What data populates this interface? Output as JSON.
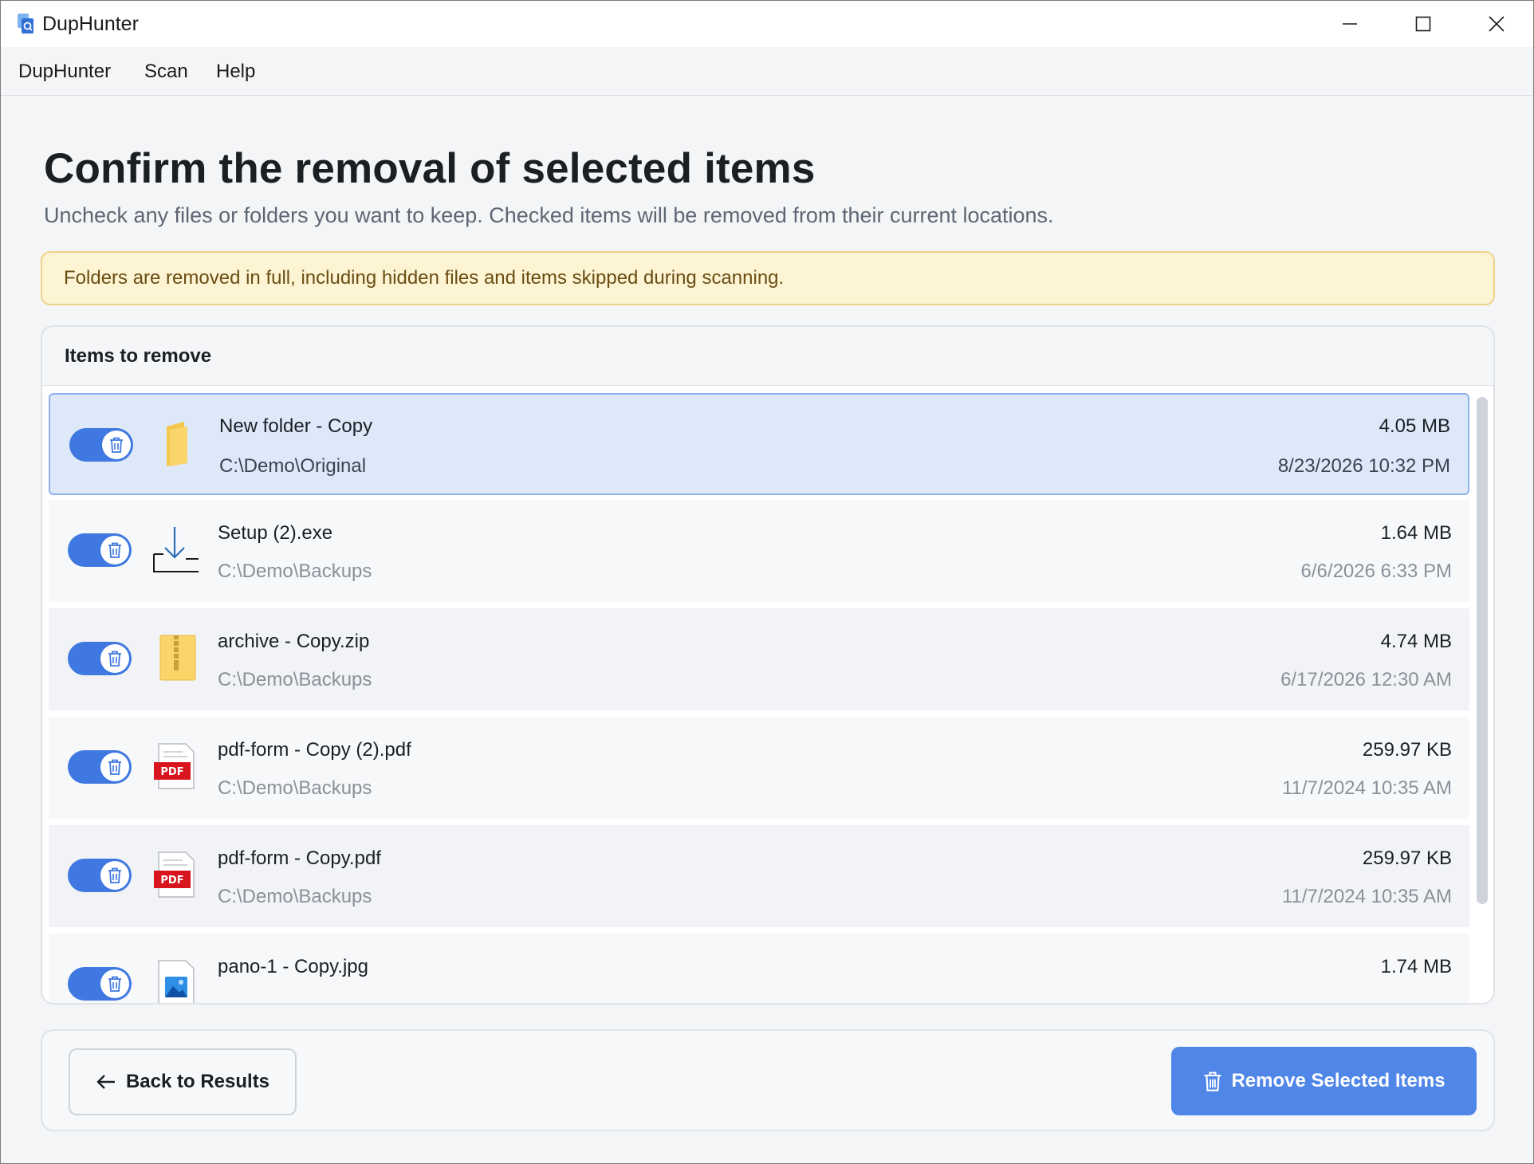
{
  "app": {
    "title": "DupHunter"
  },
  "menu": {
    "items": [
      "DupHunter",
      "Scan",
      "Help"
    ]
  },
  "header": {
    "title": "Confirm the removal of selected items",
    "subtitle": "Uncheck any files or folders you want to keep. Checked items will be removed from their current locations."
  },
  "warning": {
    "text": "Folders are removed in full, including hidden files and items skipped during scanning."
  },
  "panel": {
    "title": "Items to remove"
  },
  "items": [
    {
      "name": "New folder - Copy",
      "path": "C:\\Demo\\Original",
      "size": "4.05 MB",
      "date": "8/23/2026 10:32 PM",
      "icon": "folder-icon",
      "checked": true
    },
    {
      "name": "Setup (2).exe",
      "path": "C:\\Demo\\Backups",
      "size": "1.64 MB",
      "date": "6/6/2026 6:33 PM",
      "icon": "installer-icon",
      "checked": true
    },
    {
      "name": "archive - Copy.zip",
      "path": "C:\\Demo\\Backups",
      "size": "4.74 MB",
      "date": "6/17/2026 12:30 AM",
      "icon": "zip-folder-icon",
      "checked": true
    },
    {
      "name": "pdf-form - Copy (2).pdf",
      "path": "C:\\Demo\\Backups",
      "size": "259.97 KB",
      "date": "11/7/2024 10:35 AM",
      "icon": "pdf-icon",
      "checked": true
    },
    {
      "name": "pdf-form - Copy.pdf",
      "path": "C:\\Demo\\Backups",
      "size": "259.97 KB",
      "date": "11/7/2024 10:35 AM",
      "icon": "pdf-icon",
      "checked": true
    },
    {
      "name": "pano-1 - Copy.jpg",
      "path": "",
      "size": "1.74 MB",
      "date": "",
      "icon": "image-icon",
      "checked": true
    }
  ],
  "footer": {
    "back_label": "Back to Results",
    "remove_label": "Remove Selected Items"
  },
  "colors": {
    "accent": "#4f86e8",
    "toggle_on": "#3f78e0",
    "warning_bg": "#fdf4d4",
    "selected_row": "#dde8f9"
  }
}
